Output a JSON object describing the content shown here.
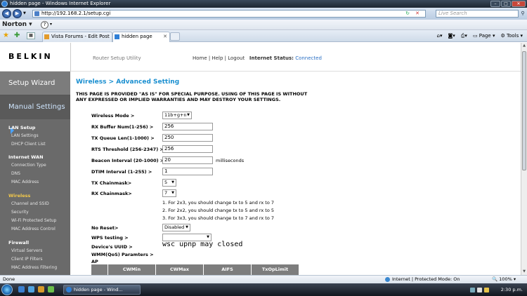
{
  "window": {
    "title": "hidden page - Windows Internet Explorer"
  },
  "addressbar": {
    "url": "http://192.168.2.1/setup.cgi",
    "search_placeholder": "Live Search"
  },
  "norton": {
    "label": "Norton"
  },
  "tabs": [
    {
      "label": "Vista Forums - Edit Post",
      "active": false
    },
    {
      "label": "hidden page",
      "active": true
    }
  ],
  "commandbar": {
    "page": "Page",
    "tools": "Tools"
  },
  "belkin": {
    "logo": "BELKIN",
    "subtitle": "Router Setup Utility",
    "links": "Home | Help | Logout",
    "internet_status_label": "Internet Status:",
    "internet_status": "Connected"
  },
  "sidebar": {
    "wizard": "Setup Wizard",
    "manual": "Manual Settings",
    "sections": [
      {
        "title": "LAN Setup",
        "items": [
          "LAN Settings",
          "DHCP Client List"
        ]
      },
      {
        "title": "Internet WAN",
        "items": [
          "Connection Type",
          "DNS",
          "MAC Address"
        ]
      },
      {
        "title": "Wireless",
        "items": [
          "Channel and SSID",
          "Security",
          "Wi-Fi Protected Setup",
          "MAC Address Control"
        ]
      },
      {
        "title": "Firewall",
        "items": [
          "Virtual Servers",
          "Client IP Filters",
          "MAC Address Filtering"
        ]
      }
    ]
  },
  "main": {
    "title": "Wireless > Advanced Setting",
    "warning": "THIS PAGE IS PROVIDED \"AS IS\" FOR SPECIAL PURPOSE. USING OF THIS PAGE IS WITHOUT ANY EXPRESSED OR IMPLIED WARRANTIES AND MAY DESTROY YOUR SETTINGS.",
    "fields": {
      "wireless_mode": {
        "label": "Wireless Mode >",
        "value": "11b+g+n"
      },
      "rx_buffer": {
        "label": "RX Buffer Num(1-256) >",
        "value": "256"
      },
      "tx_queue": {
        "label": "TX Queue Len(1-1000) >",
        "value": "250"
      },
      "rts": {
        "label": "RTS Threshold (256-2347) >",
        "value": "256"
      },
      "beacon": {
        "label": "Beacon Interval (20-1000) >",
        "value": "20",
        "unit": "milliseconds"
      },
      "dtim": {
        "label": "DTIM Interval (1-255) >",
        "value": "1"
      },
      "tx_chainmask": {
        "label": "TX Chainmask>",
        "value": "5"
      },
      "rx_chainmask": {
        "label": "RX Chainmask>",
        "value": "7"
      },
      "no_reset": {
        "label": "No Reset>",
        "value": "Disabled"
      },
      "wps_testing": {
        "label": "WPS testing >",
        "value": ""
      },
      "device_uuid": {
        "label": "Device's UUID >"
      },
      "wmm": {
        "label": "WMM(QoS) Paramters >"
      },
      "ap": {
        "label": "AP"
      }
    },
    "notes": [
      "1. For 2x3, you should change tx to 5 and rx to 7",
      "2. For 2x2, you should change tx to 5 and rx to 5",
      "3. For 3x3, you should change tx to 7 and rx to 7"
    ],
    "handwritten_note": "wsc upnp may closed",
    "table_headers": [
      "",
      "CWMin",
      "CWMax",
      "AIFS",
      "TxOpLimit"
    ]
  },
  "statusbar": {
    "done": "Done",
    "zone": "Internet | Protected Mode: On",
    "zoom": "100%"
  },
  "taskbar": {
    "task": "hidden page - Wind...",
    "clock": "2:30 p.m."
  }
}
